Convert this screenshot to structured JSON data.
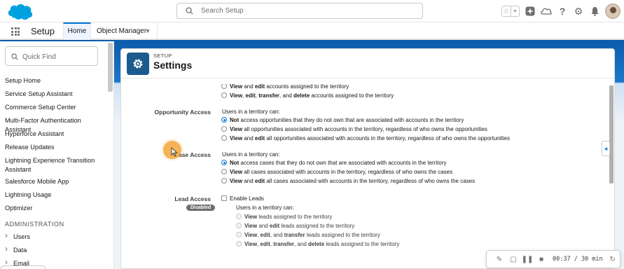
{
  "header": {
    "search_placeholder": "Search Setup",
    "icons": [
      "favorites-star-icon",
      "favorites-dropdown-icon",
      "add-icon",
      "trailhead-icon",
      "help-icon",
      "gear-icon",
      "bell-icon",
      "avatar"
    ]
  },
  "nav": {
    "app_name": "Setup",
    "tabs": [
      {
        "label": "Home",
        "active": true
      },
      {
        "label": "Object Manager",
        "active": false
      }
    ]
  },
  "sidebar": {
    "quick_find_placeholder": "Quick Find",
    "items": [
      "Setup Home",
      "Service Setup Assistant",
      "Commerce Setup Center",
      "Multi-Factor Authentication Assistant",
      "Hyperforce Assistant",
      "Release Updates",
      "Lightning Experience Transition Assistant",
      "Salesforce Mobile App",
      "Lightning Usage",
      "Optimizer"
    ],
    "section_heading": "ADMINISTRATION",
    "expandable": [
      "Users",
      "Data",
      "Email"
    ]
  },
  "page": {
    "eyebrow": "SETUP",
    "title": "Settings"
  },
  "account_access": {
    "options": [
      {
        "bold": "View",
        "mid": " and ",
        "bold2": "edit",
        "rest": " accounts assigned to the territory",
        "selected": false
      },
      {
        "bold": "View",
        "mid": ", ",
        "bold2": "edit",
        "mid2": ", ",
        "bold3": "transfer",
        "mid3": ", and ",
        "bold4": "delete",
        "rest": " accounts assigned to the territory",
        "selected": false
      }
    ]
  },
  "opportunity_access": {
    "label": "Opportunity Access",
    "intro": "Users in a territory can:",
    "options": [
      {
        "bold": "Not",
        "rest": " access opportunities that they do not own that are associated with accounts in the territory",
        "selected": true
      },
      {
        "bold": "View",
        "rest": " all opportunities associated with accounts in the territory, regardless of who owns the opportunities",
        "selected": false
      },
      {
        "bold": "View",
        "mid": " and ",
        "bold2": "edit",
        "rest": " all opportunities associated with accounts in the territory, regardless of who owns the opportunities",
        "selected": false
      }
    ]
  },
  "case_access": {
    "label": "Case Access",
    "intro": "Users in a territory can:",
    "options": [
      {
        "bold": "Not",
        "rest": " access cases that they do not own that are associated with accounts in the territory",
        "selected": true
      },
      {
        "bold": "View",
        "rest": " all cases associated with accounts in the territory, regardless of who owns the cases",
        "selected": false
      },
      {
        "bold": "View",
        "mid": " and ",
        "bold2": "edit",
        "rest": " all cases associated with accounts in the territory, regardless of who owns the cases",
        "selected": false
      }
    ]
  },
  "lead_access": {
    "label": "Lead Access",
    "badge": "Disabled",
    "checkbox_label": "Enable Leads",
    "intro": "Users in a territory can:",
    "options": [
      {
        "bold": "View",
        "rest": " leads assigned to the territory",
        "selected": true
      },
      {
        "bold": "View",
        "mid": " and ",
        "bold2": "edit",
        "rest": " leads assigned to the territory",
        "selected": false
      },
      {
        "bold": "View",
        "mid": ", ",
        "bold2": "edit",
        "mid2": ", and ",
        "bold3": "transfer",
        "rest": " leads assigned to the territory",
        "selected": false
      },
      {
        "bold": "View",
        "mid": ", ",
        "bold2": "edit",
        "mid2": ", ",
        "bold3": "transfer",
        "mid3": ", and ",
        "bold4": "delete",
        "rest": " leads assigned to the territory",
        "selected": false
      }
    ]
  },
  "recorder": {
    "time": "00:37 / 30 min",
    "icons": [
      "pen-icon",
      "note-icon",
      "pause-icon",
      "stop-icon",
      "restart-icon"
    ]
  },
  "colors": {
    "brand_blue": "#0176d3",
    "band_blue": "#0b5cab",
    "tile_blue": "#1b5b8e",
    "cursor_highlight": "#f2a63a"
  }
}
